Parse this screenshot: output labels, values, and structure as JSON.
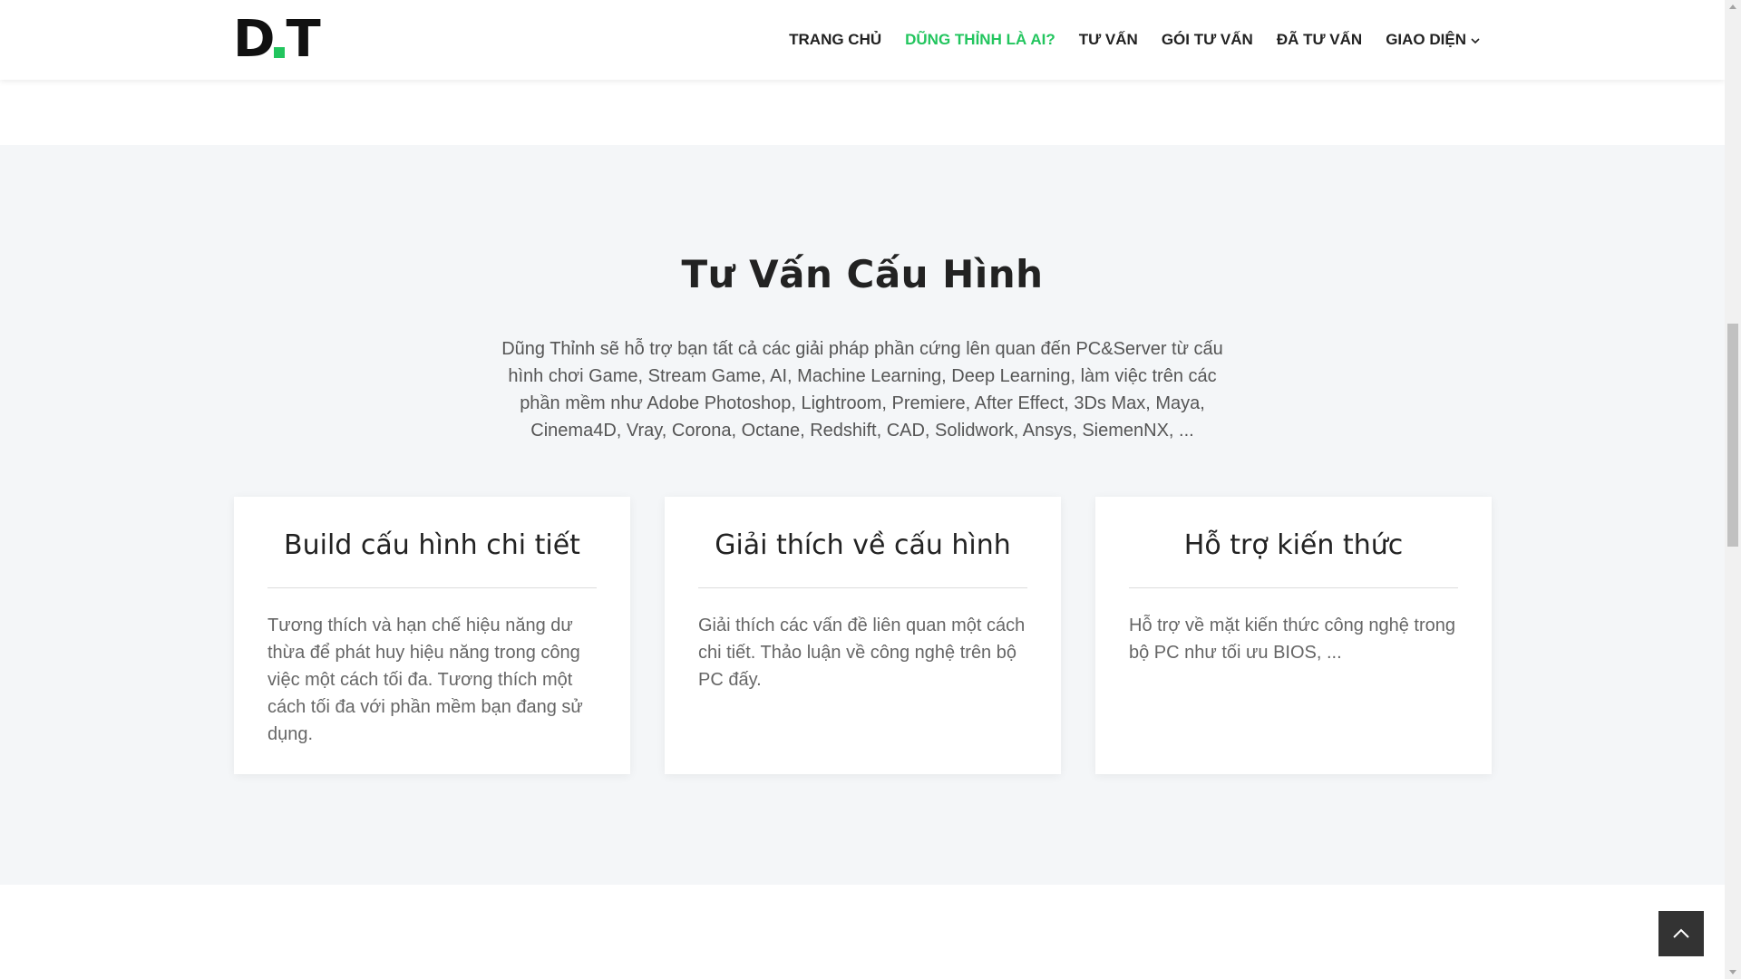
{
  "header": {
    "logo": {
      "left": "D",
      "right": "T"
    },
    "nav": [
      {
        "label": "TRANG CHỦ",
        "active": false
      },
      {
        "label": "DŨNG THỈNH LÀ AI?",
        "active": true
      },
      {
        "label": "TƯ VẤN",
        "active": false
      },
      {
        "label": "GÓI TƯ VẤN",
        "active": false
      },
      {
        "label": "ĐÃ TƯ VẤN",
        "active": false
      },
      {
        "label": "GIAO DIỆN",
        "active": false,
        "has_dropdown": true
      }
    ]
  },
  "section": {
    "title": "Tư Vấn Cấu Hình",
    "description": "Dũng Thỉnh sẽ hỗ trợ bạn tất cả các giải pháp phần cứng lên quan đến PC&Server từ cấu hình chơi Game, Stream Game, AI, Machine Learning, Deep Learning, làm việc trên các phần mềm như Adobe Photoshop, Lightroom, Premiere, After Effect, 3Ds Max, Maya, Cinema4D, Vray, Corona, Octane, Redshift, CAD, Solidwork, Ansys, SiemenNX, ...",
    "cards": [
      {
        "title": "Build cấu hình chi tiết",
        "text": "Tương thích và hạn chế hiệu năng dư thừa để phát huy hiệu năng trong công việc một cách tối đa. Tương thích một cách tối đa với phần mềm bạn đang sử dụng."
      },
      {
        "title": "Giải thích về cấu hình",
        "text": "Giải thích các vấn đề liên quan một cách chi tiết. Thảo luận về công nghệ trên bộ PC đấy."
      },
      {
        "title": "Hỗ trợ kiến thức",
        "text": "Hỗ trợ về mặt kiến thức công nghệ trong bộ PC như tối ưu BIOS, ..."
      }
    ]
  },
  "icons": {
    "nav_dropdown": "chevron-down-icon",
    "back_to_top": "chevron-up-icon"
  },
  "colors": {
    "accent": "#22c55e",
    "text_dark": "#222222",
    "section_bg": "#f4f6f8",
    "back_to_top_bg": "#333333"
  }
}
